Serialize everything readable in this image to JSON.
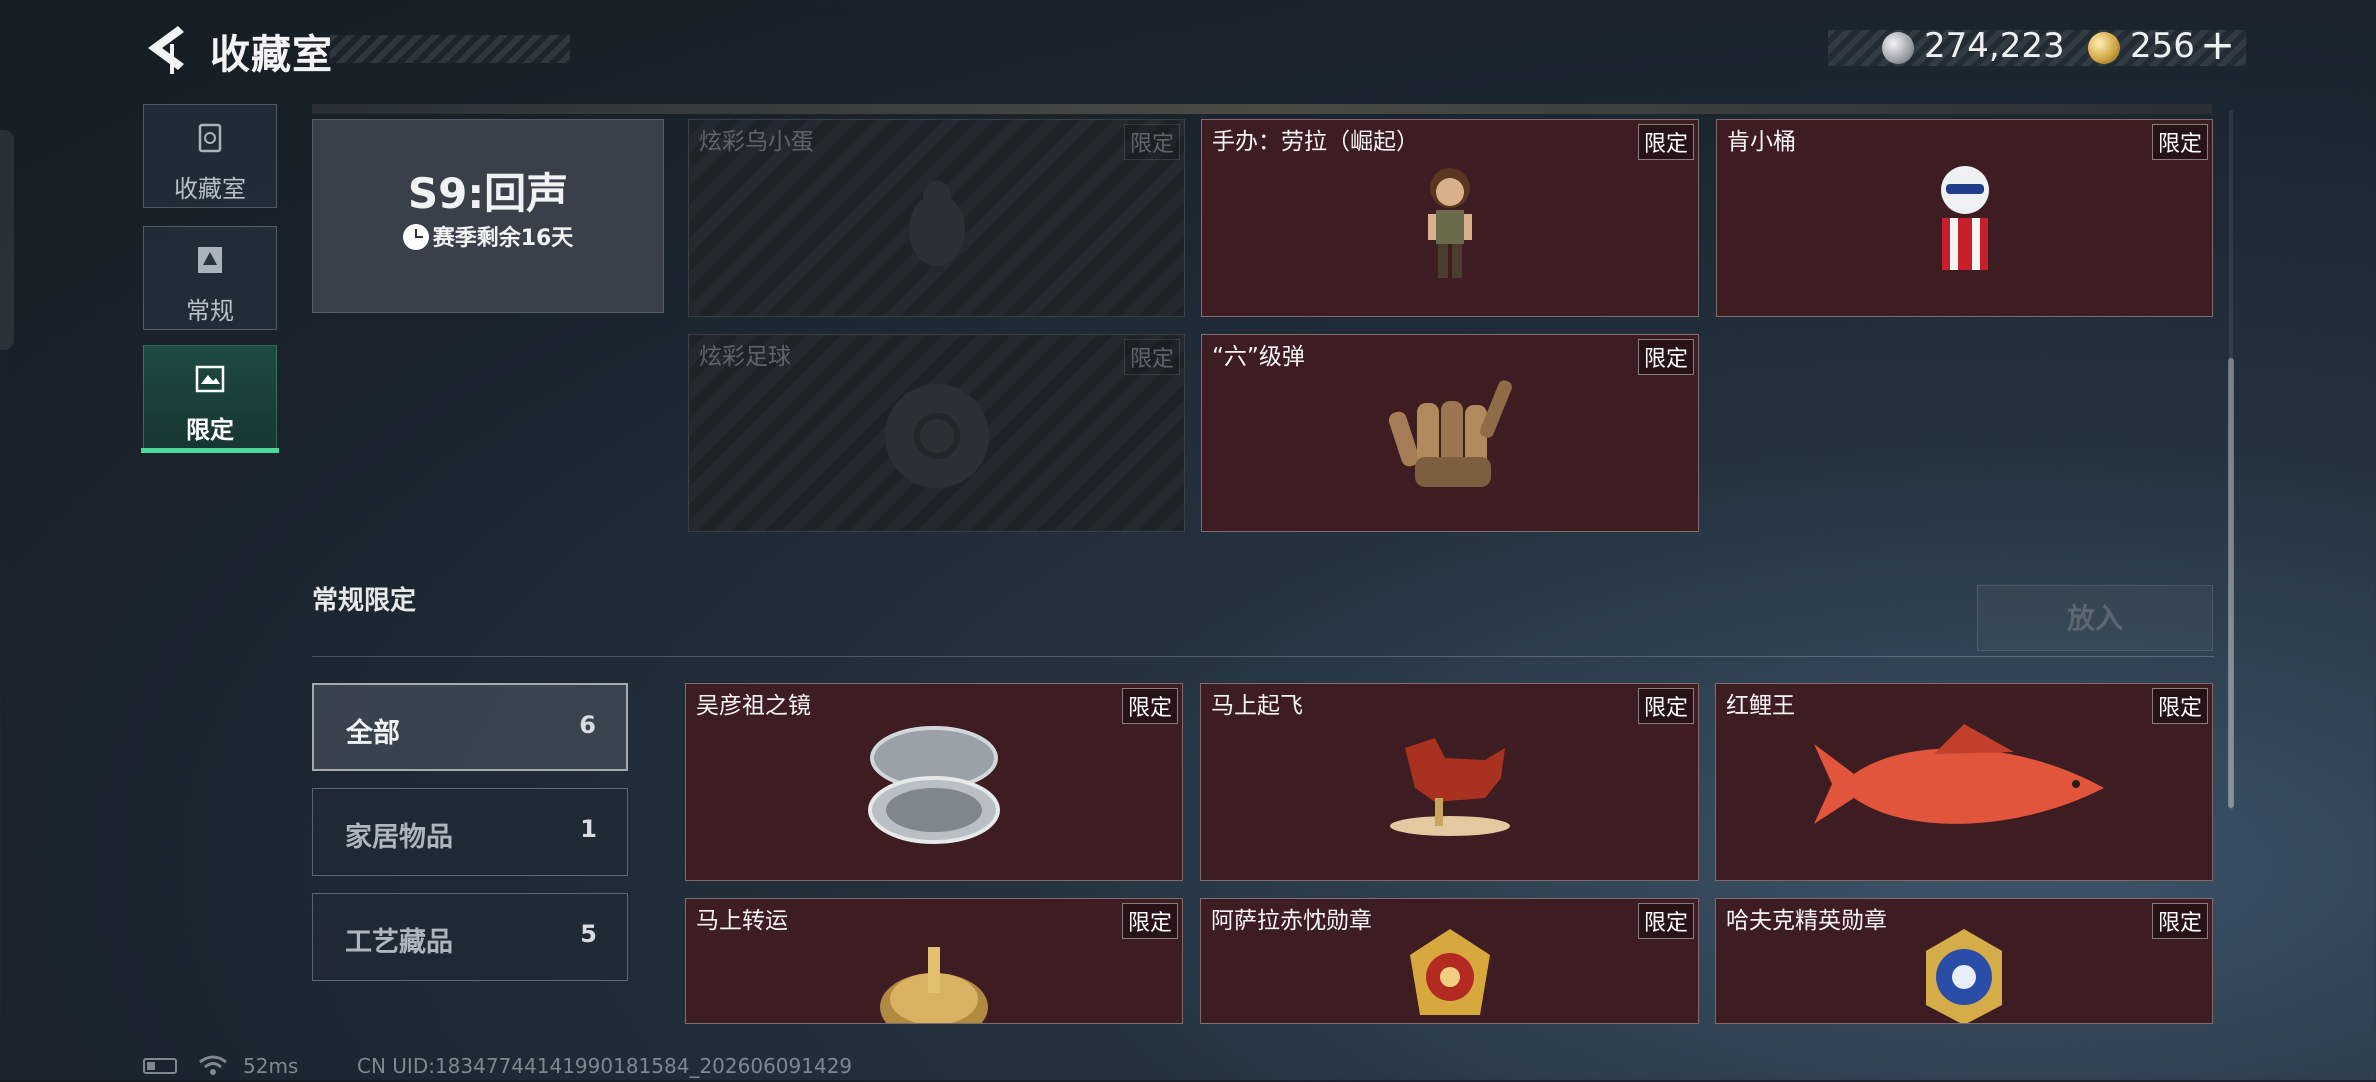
{
  "header": {
    "title": "收藏室",
    "silver_amount": "274,223",
    "gold_amount": "256",
    "plus_label": "+"
  },
  "nav": [
    {
      "label": "收藏室",
      "icon": "bin-icon"
    },
    {
      "label": "常规",
      "icon": "document-icon"
    },
    {
      "label": "限定",
      "icon": "frame-icon",
      "active": true
    }
  ],
  "season": {
    "title": "S9:回声",
    "remaining": "赛季剩余16天"
  },
  "season_items": [
    {
      "name": "炫彩乌小蛋",
      "tag": "限定",
      "locked": true
    },
    {
      "name": "手办：劳拉（崛起）",
      "tag": "限定",
      "locked": false
    },
    {
      "name": "肯小桶",
      "tag": "限定",
      "locked": false
    },
    {
      "name": "炫彩足球",
      "tag": "限定",
      "locked": true
    },
    {
      "name": "“六”级弹",
      "tag": "限定",
      "locked": false
    }
  ],
  "section": {
    "title": "常规限定",
    "put_button": "放入"
  },
  "filters": [
    {
      "label": "全部",
      "count": "6",
      "active": true
    },
    {
      "label": "家居物品",
      "count": "1"
    },
    {
      "label": "工艺藏品",
      "count": "5"
    }
  ],
  "regular_items": [
    {
      "name": "吴彦祖之镜",
      "tag": "限定"
    },
    {
      "name": "马上起飞",
      "tag": "限定"
    },
    {
      "name": "红鲤王",
      "tag": "限定"
    },
    {
      "name": "马上转运",
      "tag": "限定"
    },
    {
      "name": "阿萨拉赤忱勋章",
      "tag": "限定"
    },
    {
      "name": "哈夫克精英勋章",
      "tag": "限定"
    }
  ],
  "footer": {
    "ping": "52ms",
    "uid": "CN UID:18347744141990181584_202606091429"
  },
  "colors": {
    "accent": "#4ed89a",
    "card_red": "#3d1c22",
    "background": "#1a232c"
  }
}
